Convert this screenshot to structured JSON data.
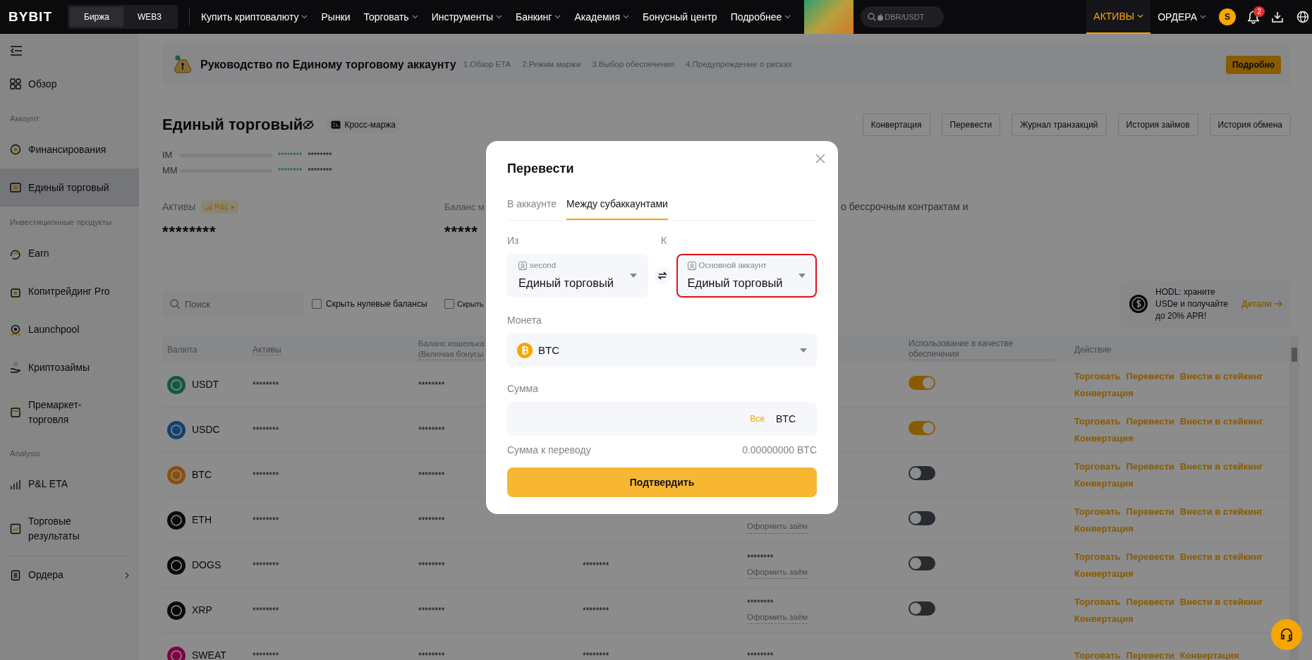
{
  "top_nav": {
    "logo": "BYBIT",
    "segments": [
      {
        "label": "Биржа",
        "selected": true
      },
      {
        "label": "WEB3",
        "selected": false
      }
    ],
    "menu": [
      {
        "label": "Купить криптовалюту",
        "dropdown": true
      },
      {
        "label": "Рынки",
        "dropdown": false
      },
      {
        "label": "Торговать",
        "dropdown": true
      },
      {
        "label": "Инструменты",
        "dropdown": true
      },
      {
        "label": "Банкинг",
        "dropdown": true
      },
      {
        "label": "Академия",
        "dropdown": true
      },
      {
        "label": "Бонусный центр",
        "dropdown": false
      },
      {
        "label": "Подробнее",
        "dropdown": true
      }
    ],
    "search": {
      "placeholder": "DBR/USDT"
    },
    "right_menu": [
      {
        "label": "АКТИВЫ",
        "selected": true
      },
      {
        "label": "ОРДЕРА",
        "selected": false
      }
    ],
    "avatar": "S",
    "notifications": "2"
  },
  "sidebar": {
    "items": [
      {
        "kind": "item",
        "label": "Обзор",
        "selected": false
      },
      {
        "kind": "section",
        "label": "Аккаунт"
      },
      {
        "kind": "item",
        "label": "Финансирования",
        "selected": false
      },
      {
        "kind": "item",
        "label": "Единый торговый",
        "selected": true
      },
      {
        "kind": "section",
        "label": "Инвестиционные продукты"
      },
      {
        "kind": "item",
        "label": "Earn",
        "selected": false
      },
      {
        "kind": "item",
        "label": "Копитрейдинг Pro",
        "selected": false
      },
      {
        "kind": "item",
        "label": "Launchpool",
        "selected": false
      },
      {
        "kind": "item",
        "label": "Криптозаймы",
        "selected": false
      },
      {
        "kind": "item",
        "label": "Премаркет-торговля",
        "selected": false
      },
      {
        "kind": "section",
        "label": "Analysis"
      },
      {
        "kind": "item",
        "label": "P&L ETA",
        "selected": false
      },
      {
        "kind": "item",
        "label": "Торговые результаты",
        "selected": false
      },
      {
        "kind": "divider"
      },
      {
        "kind": "item",
        "label": "Ордера",
        "selected": false,
        "submenu": true
      }
    ]
  },
  "guide": {
    "title": "Руководство по Единому торговому аккаунту",
    "steps": [
      "1.Обзор ETA",
      "2.Режим маржи",
      "3.Выбор обеспечения",
      "4.Предупреждение о рисках"
    ],
    "button": "Подробно"
  },
  "account": {
    "title": "Единый торговый",
    "mode": "Кросс-маржа",
    "actions": [
      "Конвертация",
      "Перевести",
      "Журнал транзакций",
      "История займов",
      "История обмена"
    ]
  },
  "margins": [
    {
      "label": "IM",
      "value_1": "********",
      "value_2": "********"
    },
    {
      "label": "MM",
      "value_1": "********",
      "value_2": "********"
    }
  ],
  "overview": {
    "assets_label": "Активы",
    "tag": "P&L",
    "assets_value": "********",
    "balance_label": "Баланс м",
    "balance_value": "*****",
    "note": "о бессрочным контрактам и"
  },
  "filters": {
    "search_placeholder": "Поиск",
    "checkboxes": [
      {
        "label": "Скрыть нулевые балансы",
        "checked": false
      },
      {
        "label": "Скрыть",
        "checked": false
      }
    ]
  },
  "promo": {
    "text": "HODL: храните USDe и получайте до 20% APR!",
    "link": "Детали"
  },
  "table": {
    "columns": [
      "Валюта",
      "Активы",
      "Баланс кошелька (Включая бонусы",
      "Использование в качестве обеспечения",
      "Действие"
    ],
    "rows": [
      {
        "coin": "USDT",
        "assets": "********",
        "wallet_balance": "********",
        "collateral": true,
        "actions": [
          "Торговать",
          "Перевести",
          "Внести в стейкинг",
          "Конвертация"
        ]
      },
      {
        "coin": "USDC",
        "assets": "********",
        "wallet_balance": "********",
        "collateral": true,
        "actions": [
          "Торговать",
          "Перевести",
          "Внести в стейкинг",
          "Конвертация"
        ]
      },
      {
        "coin": "BTC",
        "assets": "********",
        "wallet_balance": "********",
        "collateral": false,
        "actions": [
          "Торговать",
          "Перевести",
          "Внести в стейкинг",
          "Конвертация"
        ]
      },
      {
        "coin": "ETH",
        "assets": "********",
        "wallet_balance": "********",
        "column_5": {
          "link": "Оформить заём"
        },
        "collateral": false,
        "actions": [
          "Торговать",
          "Перевести",
          "Внести в стейкинг",
          "Конвертация"
        ]
      },
      {
        "coin": "DOGS",
        "assets": "********",
        "wallet_balance": "********",
        "column_4": "********",
        "column_5": {
          "value": "********",
          "link": "Оформить заём"
        },
        "collateral": false,
        "actions": [
          "Торговать",
          "Перевести",
          "Внести в стейкинг",
          "Конвертация"
        ]
      },
      {
        "coin": "XRP",
        "assets": "********",
        "wallet_balance": "********",
        "column_4": "********",
        "column_5": {
          "value": "********",
          "link": "Оформить заём"
        },
        "collateral": false,
        "actions": [
          "Торговать",
          "Перевести",
          "Внести в стейкинг",
          "Конвертация"
        ]
      },
      {
        "coin": "SWEAT",
        "assets": "********",
        "wallet_balance": "********",
        "column_4": "********",
        "column_5": {
          "value": "********"
        },
        "actions": [
          "Торговать",
          "Перевести",
          "Конвертация"
        ]
      }
    ]
  },
  "transfer_dialog": {
    "title": "Перевести",
    "tabs": [
      {
        "label": "В аккаунте",
        "selected": false
      },
      {
        "label": "Между субаккаунтами",
        "selected": true
      }
    ],
    "from": {
      "label": "Из",
      "account": "second",
      "wallet": "Единый торговый",
      "highlighted": false
    },
    "to": {
      "label": "К",
      "account": "Основной аккаунт",
      "wallet": "Единый торговый",
      "highlighted": true
    },
    "coin": {
      "label": "Монета",
      "value": "BTC"
    },
    "amount": {
      "label": "Сумма",
      "max": "Все",
      "unit": "BTC"
    },
    "transfer_label": "Сумма к переводу",
    "transfer_value": "0.00000000 BTC",
    "confirm": "Подтвердить"
  }
}
